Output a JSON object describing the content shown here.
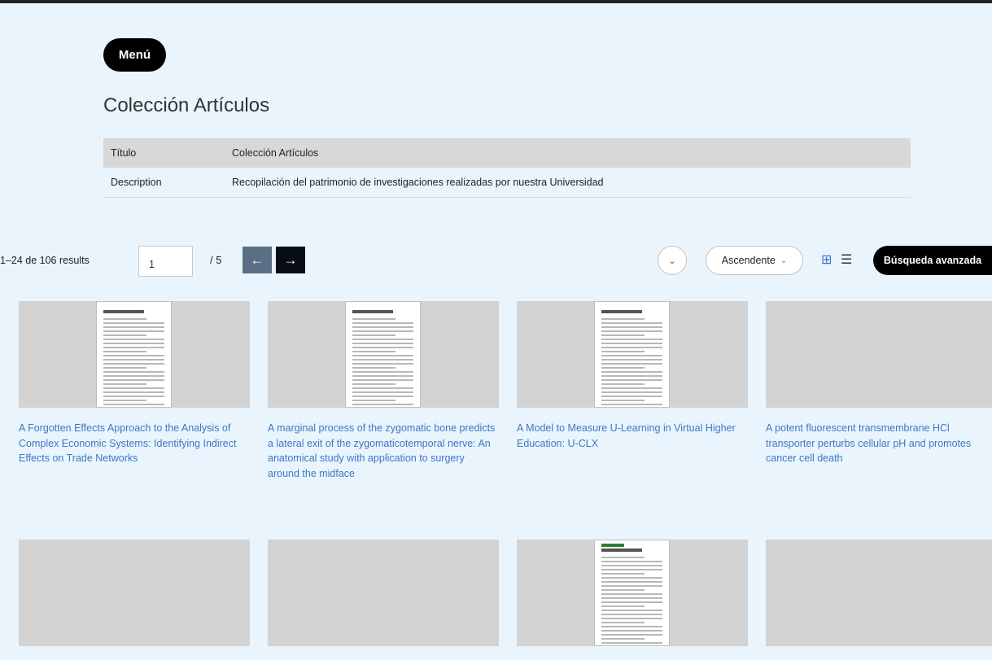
{
  "menu_label": "Menú",
  "page_title": "Colección Artículos",
  "metadata": [
    {
      "key": "Título",
      "value": "Colección Artículos"
    },
    {
      "key": "Description",
      "value": "Recopilación del patrimonio de investigaciones realizadas por nuestra Universidad"
    }
  ],
  "toolbar": {
    "results_text": "1–24 de 106 results",
    "page_value": "1",
    "page_total": "/ 5",
    "prev_icon": "←",
    "next_icon": "→",
    "sort_field_icon": "⌄",
    "sort_order": "Ascendente",
    "sort_order_icon": "⌄",
    "grid_view_icon": "⊞",
    "list_view_icon": "☰",
    "advanced_search_label": "Búsqueda avanzada"
  },
  "items": [
    {
      "title": "A Forgotten Effects Approach to the Analysis of Complex Economic Systems: Identifying Indirect Effects on Trade Networks",
      "has_thumbnail": true
    },
    {
      "title": "A marginal process of the zygomatic bone predicts a lateral exit of the zygomaticotemporal nerve: An anatomical study with application to surgery around the midface",
      "has_thumbnail": true
    },
    {
      "title": "A Model to Measure U-Learning in Virtual Higher Education: U-CLX",
      "has_thumbnail": true
    },
    {
      "title": "A potent fluorescent transmembrane HCl transporter perturbs cellular pH and promotes cancer cell death",
      "has_thumbnail": false
    },
    {
      "title": "",
      "has_thumbnail": false
    },
    {
      "title": "",
      "has_thumbnail": false
    },
    {
      "title": "",
      "has_thumbnail": true
    },
    {
      "title": "",
      "has_thumbnail": false
    }
  ],
  "colors": {
    "background": "#eaf4fc",
    "link": "#3b78c6",
    "placeholder": "#d3d3d3",
    "button_dark": "#000000",
    "prev_button": "#5a6f85",
    "grid_icon": "#3a6fd6"
  }
}
